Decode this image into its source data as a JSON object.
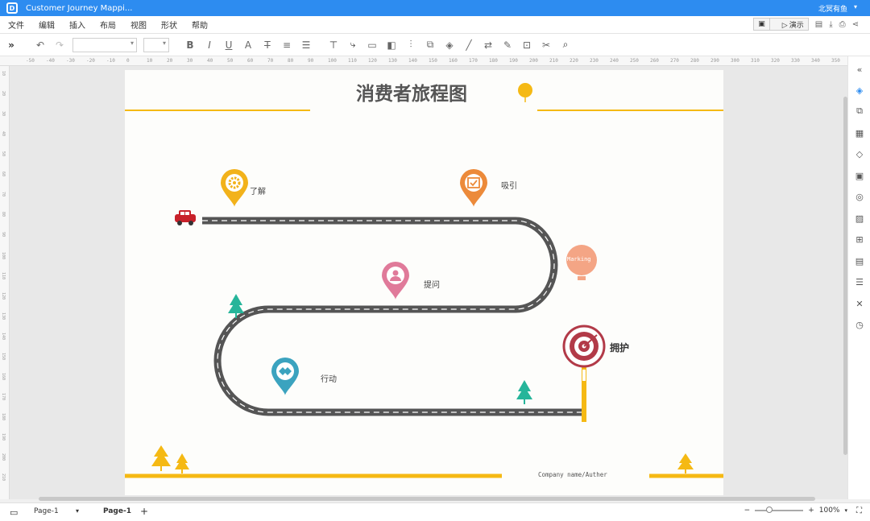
{
  "window": {
    "title": "Customer Journey Mappi...",
    "user": "北冥有鱼",
    "logo_letter": "D"
  },
  "menu": {
    "items": [
      "文件",
      "编辑",
      "插入",
      "布局",
      "视图",
      "形状",
      "帮助"
    ],
    "present_label": "演示"
  },
  "toolbar": {
    "expand_glyph": "»",
    "font_family_value": "",
    "font_size_value": ""
  },
  "ruler": {
    "top_ticks": [
      "-50",
      "-40",
      "-30",
      "-20",
      "-10",
      "0",
      "10",
      "20",
      "30",
      "40",
      "50",
      "60",
      "70",
      "80",
      "90",
      "100",
      "110",
      "120",
      "130",
      "140",
      "150",
      "160",
      "170",
      "180",
      "190",
      "200",
      "210",
      "220",
      "230",
      "240",
      "250",
      "260",
      "270",
      "280",
      "290",
      "300",
      "310",
      "320",
      "330",
      "340",
      "350"
    ],
    "left_ticks": [
      "10",
      "20",
      "30",
      "40",
      "50",
      "60",
      "70",
      "80",
      "90",
      "100",
      "110",
      "120",
      "130",
      "140",
      "150",
      "160",
      "170",
      "180",
      "190",
      "200",
      "210"
    ]
  },
  "diagram": {
    "title": "消费者旅程图",
    "stages": {
      "understand": "了解",
      "attract": "吸引",
      "ask": "提问",
      "act": "行动",
      "advocate": "拥护"
    },
    "balloon_text": "Marking",
    "footer_text": "Company name/Auther",
    "colors": {
      "yellow": "#f5b914",
      "road": "#555555",
      "red_car": "#c8212a",
      "teal_tree": "#26b59a",
      "pin_yellow": "#f2b21b",
      "pin_orange": "#ec8a3a",
      "pin_pink": "#e07a9a",
      "pin_blue": "#3ba3bf",
      "target_red": "#b23a48",
      "balloon_salmon": "#f4a585"
    }
  },
  "statusbar": {
    "page_select": "Page-1",
    "active_page": "Page-1",
    "zoom": "100%"
  }
}
